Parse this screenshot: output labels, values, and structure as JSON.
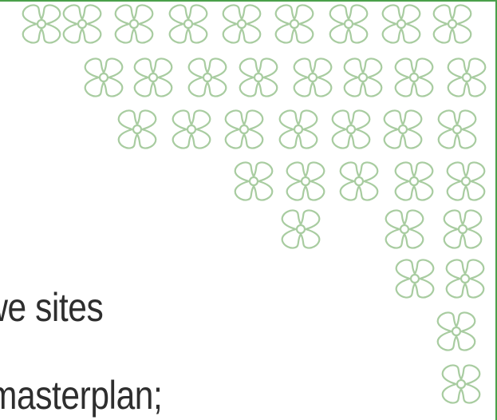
{
  "slide": {
    "body_lines": [
      "uwe sites",
      "masterplan;"
    ]
  },
  "decoration": {
    "motif_icon": "quatrefoil-knot-icon",
    "motif_color": "#a8cca0",
    "frame_color": "#4aa04a"
  }
}
